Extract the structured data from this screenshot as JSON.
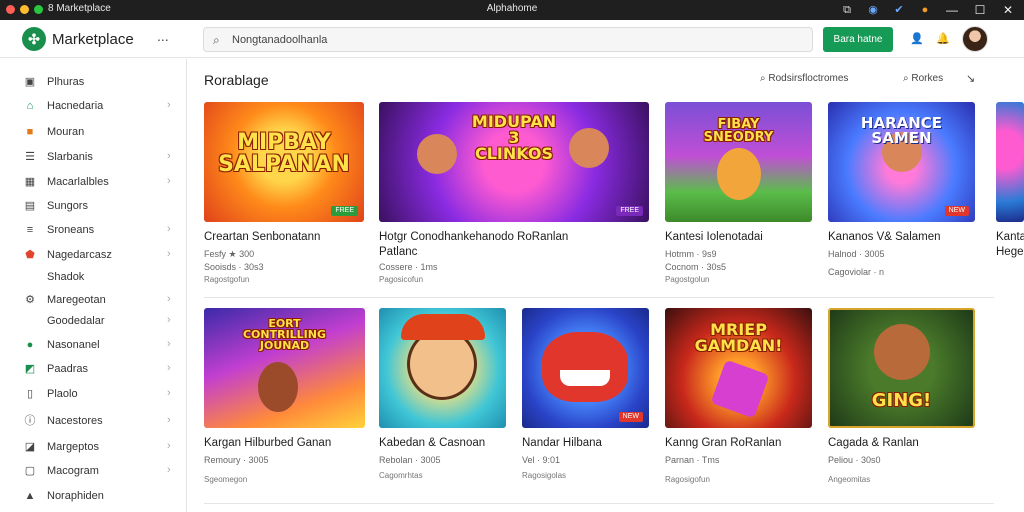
{
  "titlebar": {
    "app_name": "8 Marketplace",
    "window_title": "Alphahome",
    "icons": [
      "share-icon",
      "settings-icon",
      "extension-icon",
      "notification-icon"
    ],
    "controls": [
      "minimize",
      "maximize",
      "close"
    ]
  },
  "header": {
    "brand": "Marketplace",
    "more": "...",
    "search_placeholder": "Nongtanadoolhanla",
    "cta_label": "Bara hatne",
    "accent": "#159b55"
  },
  "sidebar": {
    "items": [
      {
        "label": "Plhuras",
        "icon": "square-icon",
        "chevron": false
      },
      {
        "label": "Hacnedaria",
        "icon": "home-icon",
        "chevron": true
      },
      {
        "label": "Mouran",
        "icon": "box-icon",
        "chevron": false
      },
      {
        "label": "Slarbanis",
        "icon": "list-icon",
        "chevron": true
      },
      {
        "label": "Macarlalbles",
        "icon": "grid-icon",
        "chevron": true
      },
      {
        "label": "Sungors",
        "icon": "document-icon",
        "chevron": false
      },
      {
        "label": "Sroneans",
        "icon": "stack-icon",
        "chevron": true
      },
      {
        "label": "Nagedarcasz",
        "icon": "shield-icon",
        "chevron": true
      },
      {
        "label": "Shadok",
        "icon": "",
        "chevron": false
      },
      {
        "label": "Maregeotan",
        "icon": "gear-icon",
        "chevron": true
      },
      {
        "label": "Goodedalar",
        "icon": "",
        "chevron": true
      },
      {
        "label": "Nasonanel",
        "icon": "circle-icon",
        "chevron": true
      },
      {
        "label": "Paadras",
        "icon": "map-icon",
        "chevron": true
      },
      {
        "label": "Plaolo",
        "icon": "file-icon",
        "chevron": true
      },
      {
        "label": "Nacestores",
        "icon": "info-icon",
        "chevron": true
      },
      {
        "label": "Margeptos",
        "icon": "chat-icon",
        "chevron": true
      },
      {
        "label": "Macogram",
        "icon": "message-icon",
        "chevron": true
      },
      {
        "label": "Noraphiden",
        "icon": "person-icon",
        "chevron": false
      }
    ]
  },
  "main": {
    "section_title": "Rorablage",
    "sort_label": "Rodsirsfloctromes",
    "filter_label": "Rorkes",
    "row1": [
      {
        "art": "MIPBAY\nSALPANAN",
        "badge": "FREE",
        "title": "Creartan Senbonatann",
        "meta": "Fesfy  ★ 300",
        "meta2": "Sooisds  ·  30s3",
        "sub": "Ragostgofun"
      },
      {
        "art": "MIDUPAN\n3\nCLINKOS",
        "badge": "FREE",
        "title": "Hotgr Conodhankehanodo RoRanlan",
        "title2": "Patlanc",
        "meta": "Cossere  ·  1ms",
        "meta2": "",
        "sub": "Pagosicofun"
      },
      {
        "art": "FIBAY\nSNEODRY",
        "badge": "",
        "title": "Kantesi Iolenotadai",
        "meta": "Hotmm  ·  9s9",
        "meta2": "Cocnom  ·  30s5",
        "sub": "Pagostgolun"
      },
      {
        "art": "HARANCE\nSAMEN",
        "badge": "NEW",
        "title": "Kananos V& Salamen",
        "meta": "Halnod  ·  3005",
        "meta2": "Cagoviolar  ·  n",
        "sub": ""
      },
      {
        "art": "",
        "badge": "",
        "title": "Kanta",
        "title2": "Hege",
        "meta": "",
        "meta2": "",
        "sub": ""
      }
    ],
    "row2": [
      {
        "art": "EORT\nCONTRILLING\nJOUNAD",
        "badge": "",
        "title": "Kargan Hilburbed Ganan",
        "meta": "Remoury  ·  3005",
        "meta2": "",
        "sub": "Sgeomegon"
      },
      {
        "art": "",
        "badge": "",
        "title": "Kabedan & Casnoan",
        "meta": "Rebolan  ·  3005",
        "meta2": "",
        "sub": "Cagomrhtas"
      },
      {
        "art": "",
        "badge": "NEW",
        "title": "Nandar Hilbana",
        "meta": "Vel  ·  9:01",
        "meta2": "",
        "sub": "Ragosigolas"
      },
      {
        "art": "MRIEP\nGAMDAN!",
        "badge": "",
        "title": "Kanng Gran RoRanlan",
        "meta": "Parnan  ·  Tms",
        "meta2": "",
        "sub": "Ragosigofun"
      },
      {
        "art": "GING!",
        "badge": "",
        "title": "Cagada & Ranlan",
        "meta": "Peliou  ·  30s0",
        "meta2": "",
        "sub": "Angeomitas"
      }
    ]
  }
}
